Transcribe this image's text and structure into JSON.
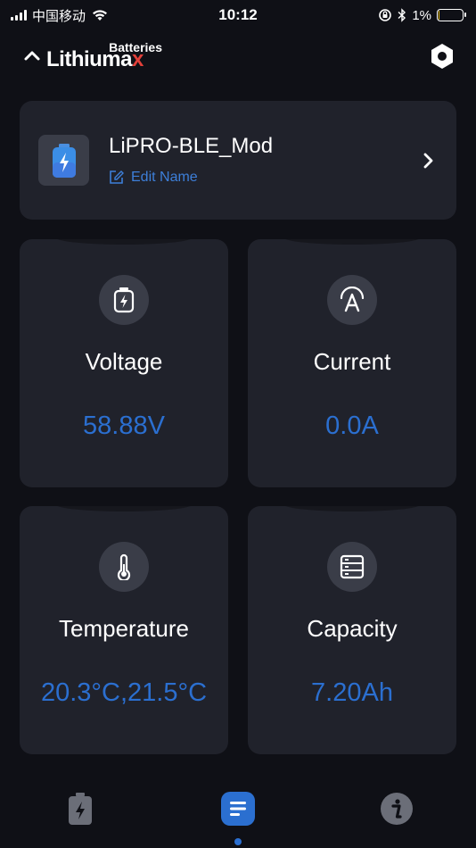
{
  "status_bar": {
    "carrier": "中国移动",
    "time": "10:12",
    "battery_percent": "1%",
    "battery_level": 0.05
  },
  "header": {
    "logo_top": "Batteries",
    "logo_main_prefix": "Lithiuma",
    "logo_main_accent": "x",
    "icons": [
      "chevron-up-icon",
      "settings-hexagon-icon"
    ]
  },
  "device": {
    "name": "LiPRO-BLE_Mod",
    "edit_label": "Edit Name",
    "icon": "battery-charging-icon"
  },
  "metrics": [
    {
      "id": "voltage",
      "label": "Voltage",
      "value": "58.88V",
      "icon": "battery-bolt-icon"
    },
    {
      "id": "current",
      "label": "Current",
      "value": "0.0A",
      "icon": "current-a-icon"
    },
    {
      "id": "temperature",
      "label": "Temperature",
      "value": "20.3°C,21.5°C",
      "icon": "thermometer-icon"
    },
    {
      "id": "capacity",
      "label": "Capacity",
      "value": "7.20Ah",
      "icon": "storage-stack-icon"
    }
  ],
  "tab_bar": {
    "tabs": [
      {
        "id": "battery",
        "icon": "battery-tab-icon",
        "active": false
      },
      {
        "id": "data",
        "icon": "list-tab-icon",
        "active": true
      },
      {
        "id": "info",
        "icon": "info-tab-icon",
        "active": false
      }
    ]
  },
  "colors": {
    "background": "#0f1016",
    "card": "#20222b",
    "accent_blue": "#2b6fd0",
    "icon_circle": "#3a3d48",
    "logo_red": "#e2403a"
  }
}
